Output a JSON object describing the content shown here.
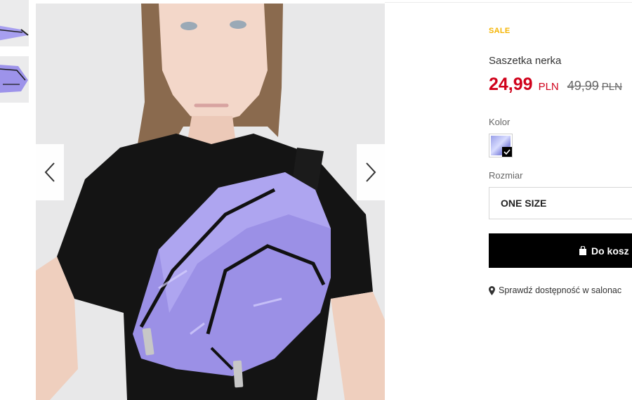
{
  "gallery": {
    "thumbnails": [
      "product-thumbnail",
      "product-thumbnail"
    ],
    "prev_icon": "chevron-left-icon",
    "next_icon": "chevron-right-icon"
  },
  "product": {
    "badge": "SALE",
    "title": "Saszetka nerka",
    "price": "24,99",
    "currency": "PLN",
    "old_price": "49,99",
    "old_currency": "PLN"
  },
  "options": {
    "color_label": "Kolor",
    "color_selected_icon": "checkmark-icon",
    "size_label": "Rozmiar",
    "size_value": "ONE SIZE"
  },
  "actions": {
    "cart_label": "Do kosz",
    "cart_icon": "shopping-bag-icon",
    "store_link": "Sprawdź dostępność w salonac",
    "store_icon": "location-pin-icon"
  },
  "colors": {
    "sale": "#f5b400",
    "price": "#d0021b",
    "button": "#000000",
    "bag": "#9b90e6"
  }
}
